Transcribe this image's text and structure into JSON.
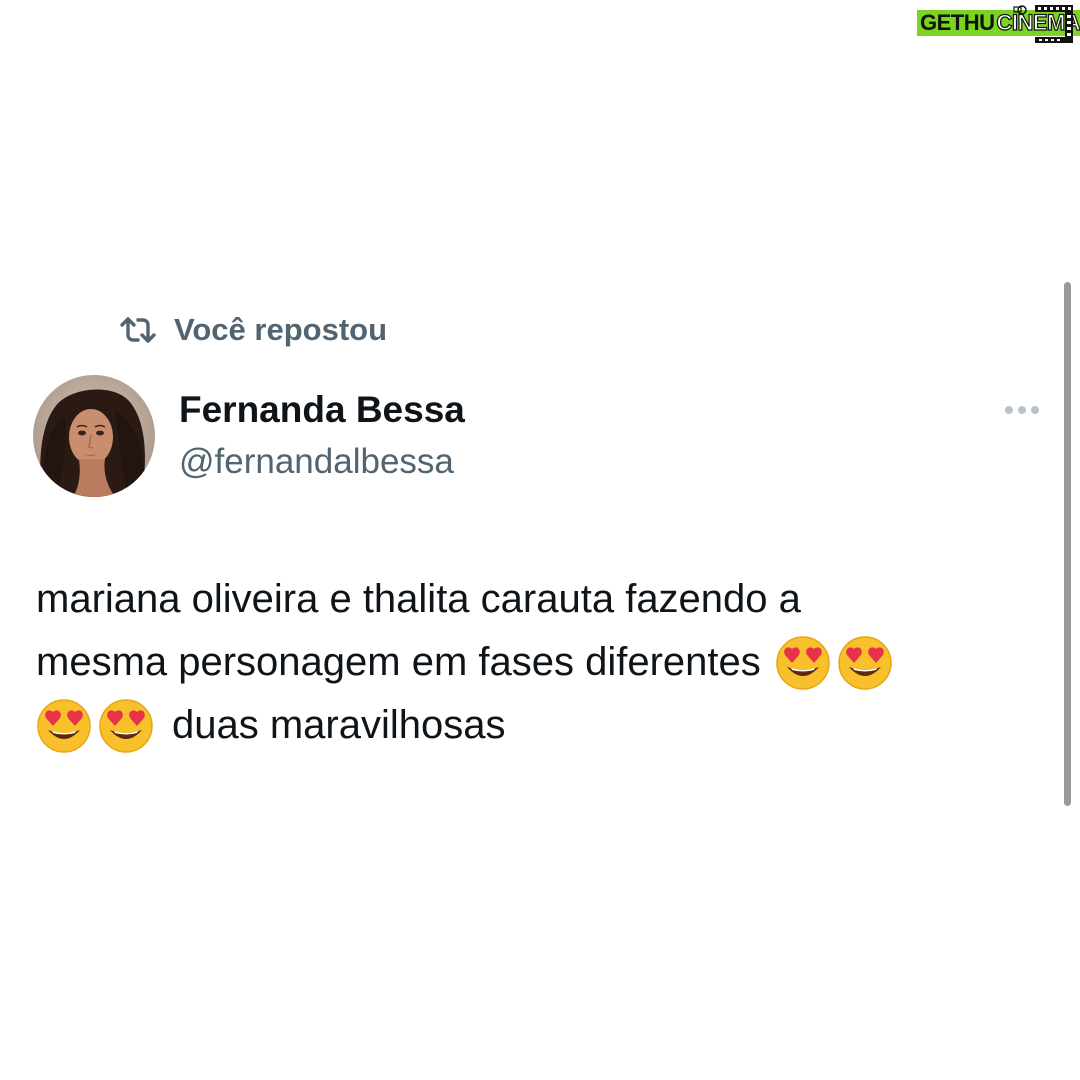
{
  "watermark": {
    "part1": "GETHU",
    "part2": "CINEMA"
  },
  "repost": {
    "icon": "repost-icon",
    "label": "Você repostou"
  },
  "author": {
    "display_name": "Fernanda Bessa",
    "handle": "@fernandalbessa",
    "avatar_icon": "avatar"
  },
  "more_menu": {
    "icon": "more-horizontal-icon"
  },
  "tweet": {
    "line1": "mariana oliveira e thalita carauta fazendo a",
    "line2": "mesma personagem em fases diferentes",
    "line3": "duas maravilhosas",
    "emoji": "smiling-face-with-heart-eyes-emoji"
  },
  "colors": {
    "primary_text": "#0f1419",
    "secondary_text": "#536471",
    "watermark_green": "#7bd322"
  }
}
